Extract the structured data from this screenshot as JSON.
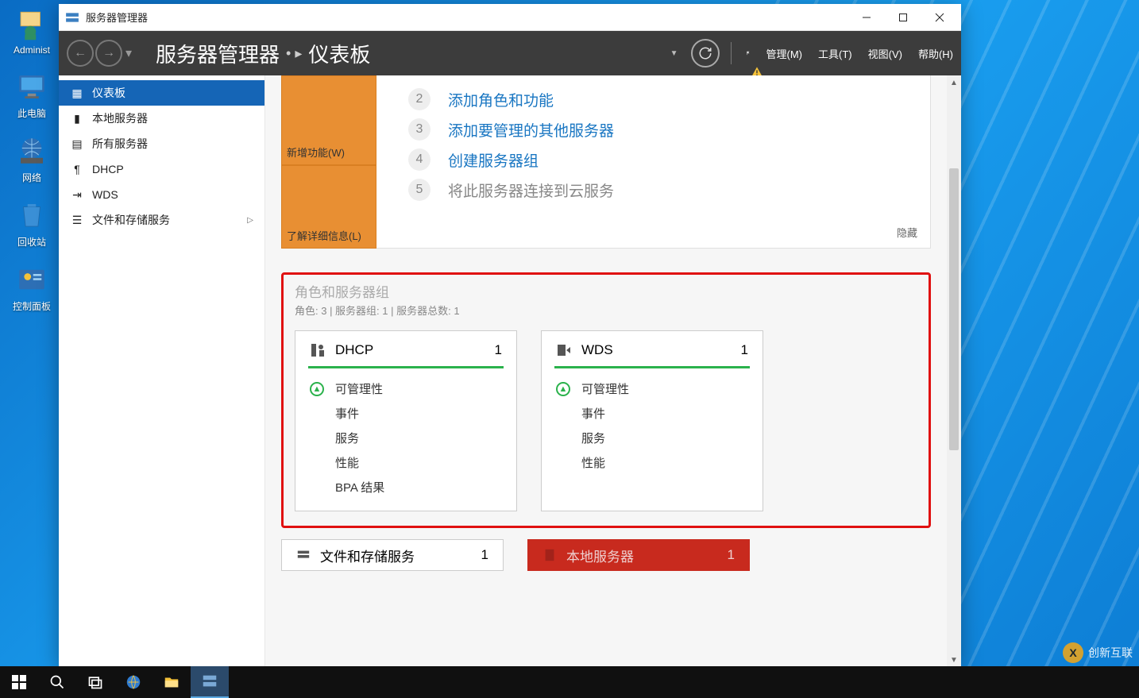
{
  "desktop": {
    "icons": [
      "Administ",
      "此电脑",
      "网络",
      "回收站",
      "控制面板"
    ]
  },
  "window": {
    "title": "服务器管理器"
  },
  "breadcrumb": {
    "app": "服务器管理器",
    "page": "仪表板"
  },
  "menus": {
    "manage": "管理(M)",
    "tools": "工具(T)",
    "view": "视图(V)",
    "help": "帮助(H)"
  },
  "sidebar": {
    "items": [
      {
        "label": "仪表板",
        "selected": true,
        "icon": "dashboard"
      },
      {
        "label": "本地服务器",
        "icon": "server"
      },
      {
        "label": "所有服务器",
        "icon": "servers"
      },
      {
        "label": "DHCP",
        "icon": "dhcp"
      },
      {
        "label": "WDS",
        "icon": "wds"
      },
      {
        "label": "文件和存储服务",
        "icon": "files",
        "expandable": true
      }
    ]
  },
  "welcome": {
    "box1": "新增功能(W)",
    "box2": "了解详细信息(L)",
    "steps": [
      {
        "n": "2",
        "t": "添加角色和功能",
        "blue": true
      },
      {
        "n": "3",
        "t": "添加要管理的其他服务器",
        "blue": true
      },
      {
        "n": "4",
        "t": "创建服务器组",
        "blue": true
      },
      {
        "n": "5",
        "t": "将此服务器连接到云服务",
        "blue": false
      }
    ],
    "hide": "隐藏"
  },
  "group": {
    "title": "角色和服务器组",
    "subtitle": "角色: 3 | 服务器组: 1 | 服务器总数: 1",
    "tiles": [
      {
        "name": "DHCP",
        "count": "1",
        "rows": [
          "可管理性",
          "事件",
          "服务",
          "性能",
          "BPA 结果"
        ]
      },
      {
        "name": "WDS",
        "count": "1",
        "rows": [
          "可管理性",
          "事件",
          "服务",
          "性能"
        ]
      }
    ]
  },
  "partial": {
    "a": {
      "name": "文件和存储服务",
      "count": "1"
    },
    "b": {
      "name": "本地服务器",
      "count": "1"
    }
  },
  "watermark": "创新互联"
}
